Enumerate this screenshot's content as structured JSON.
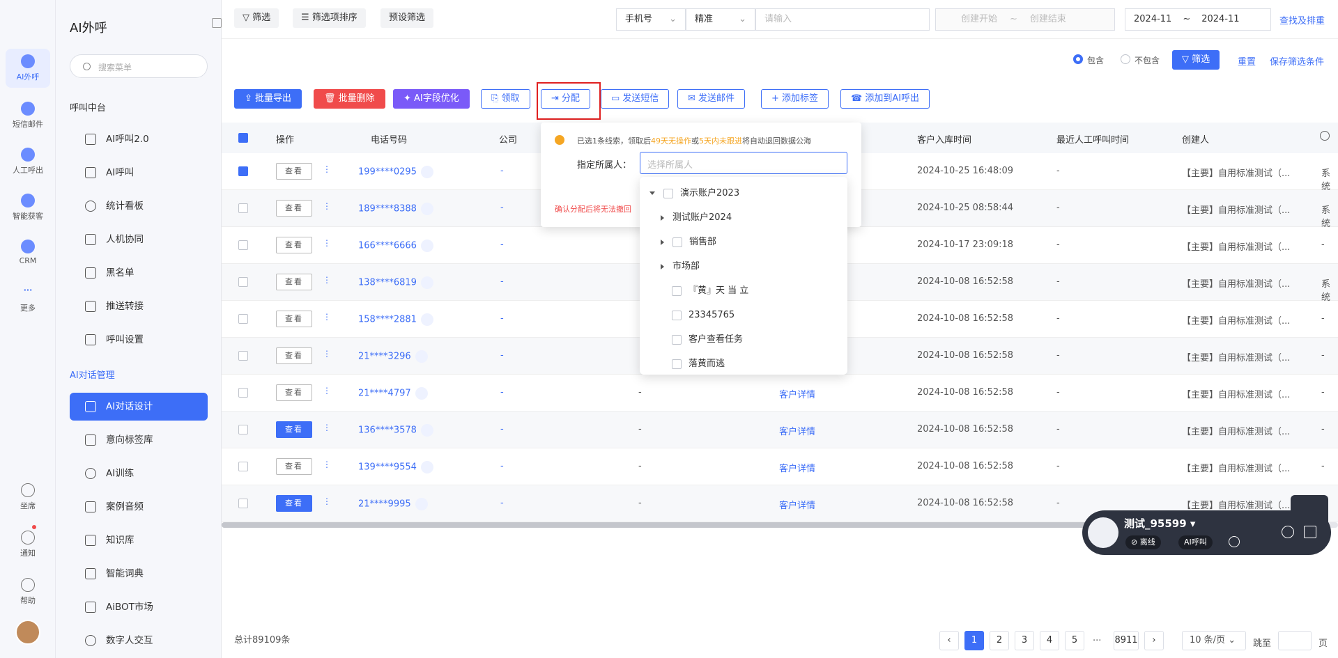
{
  "leftnav": {
    "items": [
      {
        "label": "AI外呼",
        "icon": "ai-robot-icon"
      },
      {
        "label": "短信邮件",
        "icon": "message-icon"
      },
      {
        "label": "人工呼出",
        "icon": "headset-icon"
      },
      {
        "label": "智能获客",
        "icon": "target-icon"
      },
      {
        "label": "CRM",
        "icon": "crm-icon"
      },
      {
        "label": "更多",
        "icon": "more-icon"
      }
    ],
    "bottom": [
      {
        "label": "坐席",
        "icon": "agent-icon"
      },
      {
        "label": "通知",
        "icon": "bell-icon"
      },
      {
        "label": "帮助",
        "icon": "help-icon"
      }
    ]
  },
  "sidebar": {
    "title": "AI外呼",
    "search_placeholder": "搜索菜单",
    "group1": "呼叫中台",
    "group1_items": [
      {
        "label": "AI呼叫2.0"
      },
      {
        "label": "AI呼叫"
      },
      {
        "label": "统计看板"
      },
      {
        "label": "人机协同"
      },
      {
        "label": "黑名单"
      },
      {
        "label": "推送转接"
      },
      {
        "label": "呼叫设置"
      }
    ],
    "group2": "AI对话管理",
    "group2_items": [
      {
        "label": "AI对话设计"
      },
      {
        "label": "意向标签库"
      },
      {
        "label": "AI训练"
      },
      {
        "label": "案例音频"
      },
      {
        "label": "知识库"
      },
      {
        "label": "智能词典"
      },
      {
        "label": "AiBOT市场"
      },
      {
        "label": "数字人交互"
      }
    ]
  },
  "topbar": {
    "filter": "筛选",
    "sort": "筛选项排序",
    "preset": "预设筛选",
    "field_type": "手机号",
    "match": "精准",
    "input_placeholder": "请输入",
    "create_start": "创建开始",
    "tilde": "~",
    "create_end": "创建结束",
    "month_start": "2024-11",
    "month_end": "2024-11",
    "dedupe": "查找及排重"
  },
  "filterbar": {
    "include": "包含",
    "exclude": "不包含",
    "filter_btn": "筛选",
    "reset": "重置",
    "save": "保存筛选条件"
  },
  "actions": {
    "export": "批量导出",
    "delete": "批量删除",
    "ai_opt": "AI字段优化",
    "claim": "领取",
    "assign": "分配",
    "sms": "发送短信",
    "email": "发送邮件",
    "tag": "添加标签",
    "add_ai": "添加到AI呼出"
  },
  "table": {
    "headers": {
      "op": "操作",
      "phone": "电话号码",
      "company": "公司",
      "in_time": "客户入库时间",
      "last_call": "最近人工呼叫时间",
      "creator": "创建人"
    },
    "view": "查看",
    "rows": [
      {
        "phone": "199****0295",
        "company": "-",
        "c3": "",
        "detail": "",
        "time": "2024-10-25 16:48:09",
        "last": "-",
        "creator": "【主要】自用标准测试（...",
        "extra": "系统",
        "checked": true,
        "filled": false
      },
      {
        "phone": "189****8388",
        "company": "-",
        "c3": "",
        "detail": "",
        "time": "2024-10-25 08:58:44",
        "last": "-",
        "creator": "【主要】自用标准测试（...",
        "extra": "系统",
        "checked": false,
        "filled": false
      },
      {
        "phone": "166****6666",
        "company": "-",
        "c3": "",
        "detail": "",
        "time": "2024-10-17 23:09:18",
        "last": "-",
        "creator": "【主要】自用标准测试（...",
        "extra": "-",
        "checked": false,
        "filled": false
      },
      {
        "phone": "138****6819",
        "company": "-",
        "c3": "",
        "detail": "",
        "time": "2024-10-08 16:52:58",
        "last": "-",
        "creator": "【主要】自用标准测试（...",
        "extra": "系统",
        "checked": false,
        "filled": false
      },
      {
        "phone": "158****2881",
        "company": "-",
        "c3": "",
        "detail": "",
        "time": "2024-10-08 16:52:58",
        "last": "-",
        "creator": "【主要】自用标准测试（...",
        "extra": "-",
        "checked": false,
        "filled": false
      },
      {
        "phone": "21****3296",
        "company": "-",
        "c3": "",
        "detail": "",
        "time": "2024-10-08 16:52:58",
        "last": "-",
        "creator": "【主要】自用标准测试（...",
        "extra": "-",
        "checked": false,
        "filled": false
      },
      {
        "phone": "21****4797",
        "company": "-",
        "c3": "-",
        "detail": "客户详情",
        "time": "2024-10-08 16:52:58",
        "last": "-",
        "creator": "【主要】自用标准测试（...",
        "extra": "-",
        "checked": false,
        "filled": false
      },
      {
        "phone": "136****3578",
        "company": "-",
        "c3": "-",
        "detail": "客户详情",
        "time": "2024-10-08 16:52:58",
        "last": "-",
        "creator": "【主要】自用标准测试（...",
        "extra": "-",
        "checked": false,
        "filled": true
      },
      {
        "phone": "139****9554",
        "company": "-",
        "c3": "-",
        "detail": "客户详情",
        "time": "2024-10-08 16:52:58",
        "last": "-",
        "creator": "【主要】自用标准测试（...",
        "extra": "-",
        "checked": false,
        "filled": false
      },
      {
        "phone": "21****9995",
        "company": "-",
        "c3": "-",
        "detail": "客户详情",
        "time": "2024-10-08 16:52:58",
        "last": "-",
        "creator": "【主要】自用标准测试（...",
        "extra": "",
        "checked": false,
        "filled": true
      }
    ]
  },
  "popover": {
    "note_a": "已选1条线索，领取后",
    "note_b": "49天无操作",
    "note_c": "或",
    "note_d": "5天内未跟进",
    "note_e": "将自动退回数据公海",
    "label": "指定所属人：",
    "placeholder": "选择所属人",
    "warning": "确认分配后将无法撤回"
  },
  "tree": [
    {
      "label": "演示账户2023"
    },
    {
      "label": "测试账户2024"
    },
    {
      "label": "销售部"
    },
    {
      "label": "市场部"
    },
    {
      "label": "『黄』天 当 立"
    },
    {
      "label": "23345765"
    },
    {
      "label": "客户查看任务"
    },
    {
      "label": "落黄而逃"
    }
  ],
  "footer": {
    "total": "总计89109条",
    "pages": [
      "1",
      "2",
      "3",
      "4",
      "5"
    ],
    "ellipsis": "···",
    "last": "8911",
    "per_page": "10 条/页",
    "goto": "跳至",
    "page_unit": "页"
  },
  "callwidget": {
    "name": "测试_95599",
    "status": "离线",
    "mode": "AI呼叫"
  },
  "colors": {
    "primary": "#3d6ef7",
    "danger": "#f04b4b",
    "ai": "#7a5af8",
    "warn": "#f5a623"
  }
}
